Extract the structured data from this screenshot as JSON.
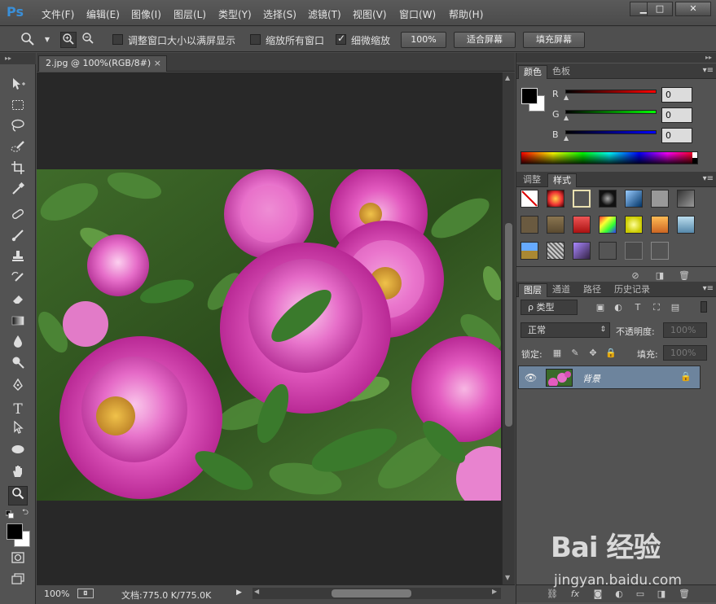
{
  "app": {
    "logo": "Ps",
    "menu": [
      "文件(F)",
      "编辑(E)",
      "图像(I)",
      "图层(L)",
      "类型(Y)",
      "选择(S)",
      "滤镜(T)",
      "视图(V)",
      "窗口(W)",
      "帮助(H)"
    ],
    "window_controls": {
      "minimize": "▁",
      "maximize": "□",
      "close": "✕"
    }
  },
  "options_bar": {
    "checkbox_resize_windows": {
      "label": "调整窗口大小以满屏显示",
      "checked": false
    },
    "checkbox_zoom_all": {
      "label": "缩放所有窗口",
      "checked": false
    },
    "checkbox_scrubby_zoom": {
      "label": "细微缩放",
      "checked": true
    },
    "btn_100": "100%",
    "btn_fit_screen": "适合屏幕",
    "btn_fill_screen": "填充屏幕"
  },
  "document": {
    "tab_title": "2.jpg @ 100%(RGB/8#)",
    "tab_close": "×"
  },
  "status": {
    "zoom": "100%",
    "doc_size": "文档:775.0 K/775.0K"
  },
  "color_panel": {
    "tabs": [
      "颜色",
      "色板"
    ],
    "active_tab": 0,
    "channels": [
      {
        "label": "R",
        "value": "0",
        "color": "#ff0000"
      },
      {
        "label": "G",
        "value": "0",
        "color": "#00ff00"
      },
      {
        "label": "B",
        "value": "0",
        "color": "#0000ff"
      }
    ]
  },
  "styles_panel": {
    "tabs": [
      "调整",
      "样式"
    ],
    "active_tab": 1
  },
  "layers_panel": {
    "tabs": [
      "图层",
      "通道",
      "路径",
      "历史记录"
    ],
    "active_tab": 0,
    "filter_kind": "ρ 类型",
    "blend_mode": "正常",
    "opacity_label": "不透明度:",
    "opacity_value": "100%",
    "lock_label": "锁定:",
    "fill_label": "填充:",
    "fill_value": "100%",
    "layers": [
      {
        "name": "背景",
        "visible": true,
        "locked": true
      }
    ]
  },
  "watermark": {
    "brand": "Bai 经验",
    "url": "jingyan.baidu.com"
  }
}
